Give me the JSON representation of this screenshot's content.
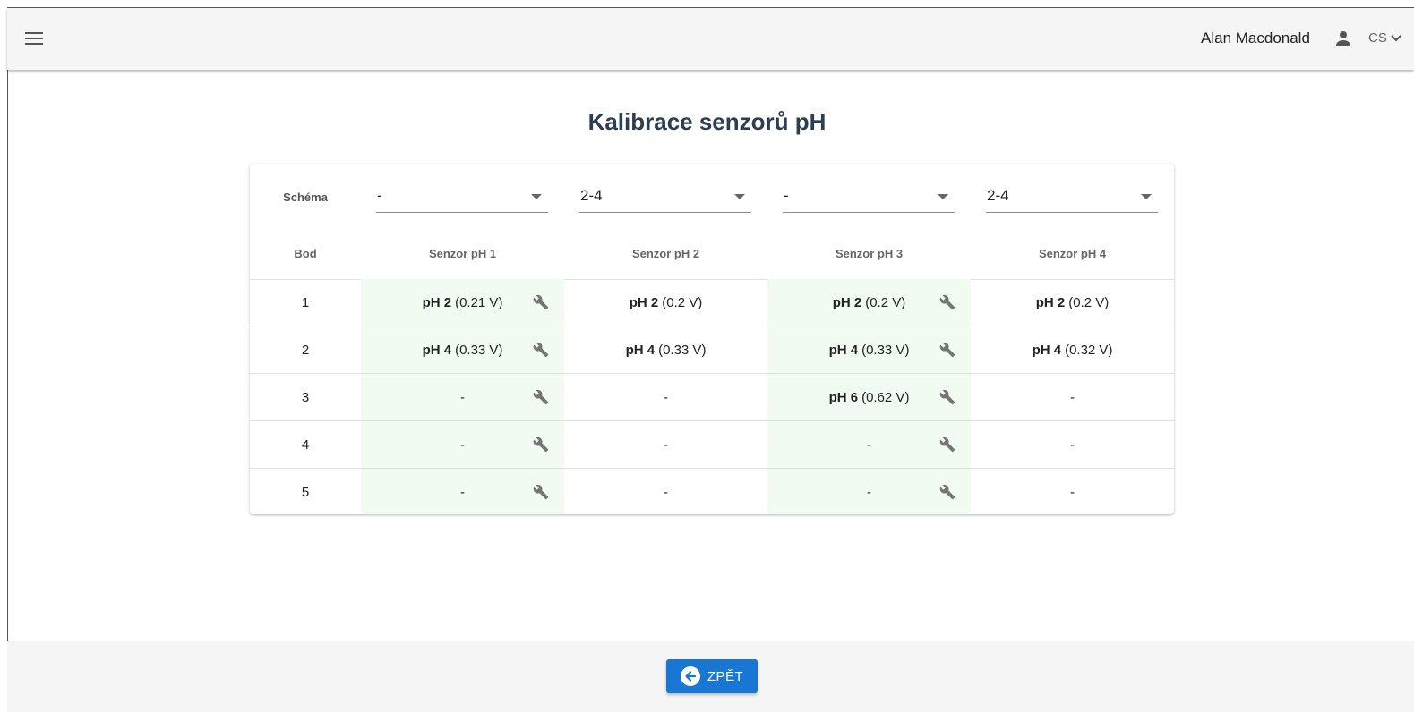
{
  "header": {
    "user_name": "Alan Macdonald",
    "language": "CS"
  },
  "page": {
    "title": "Kalibrace senzorů pH"
  },
  "schema": {
    "label": "Schéma",
    "selects": [
      {
        "value": "-"
      },
      {
        "value": "2-4"
      },
      {
        "value": "-"
      },
      {
        "value": "2-4"
      }
    ]
  },
  "table": {
    "headers": [
      "Bod",
      "Senzor pH 1",
      "Senzor pH 2",
      "Senzor pH 3",
      "Senzor pH 4"
    ],
    "rows": [
      {
        "point": "1",
        "cells": [
          {
            "ph": "pH 2",
            "volt": "(0.21 V)",
            "dash": ""
          },
          {
            "ph": "pH 2",
            "volt": "(0.2 V)",
            "dash": ""
          },
          {
            "ph": "pH 2",
            "volt": "(0.2 V)",
            "dash": ""
          },
          {
            "ph": "pH 2",
            "volt": "(0.2 V)",
            "dash": ""
          }
        ]
      },
      {
        "point": "2",
        "cells": [
          {
            "ph": "pH 4",
            "volt": "(0.33 V)",
            "dash": ""
          },
          {
            "ph": "pH 4",
            "volt": "(0.33 V)",
            "dash": ""
          },
          {
            "ph": "pH 4",
            "volt": "(0.33 V)",
            "dash": ""
          },
          {
            "ph": "pH 4",
            "volt": "(0.32 V)",
            "dash": ""
          }
        ]
      },
      {
        "point": "3",
        "cells": [
          {
            "ph": "",
            "volt": "",
            "dash": "-"
          },
          {
            "ph": "",
            "volt": "",
            "dash": "-"
          },
          {
            "ph": "pH 6",
            "volt": "(0.62 V)",
            "dash": ""
          },
          {
            "ph": "",
            "volt": "",
            "dash": "-"
          }
        ]
      },
      {
        "point": "4",
        "cells": [
          {
            "ph": "",
            "volt": "",
            "dash": "-"
          },
          {
            "ph": "",
            "volt": "",
            "dash": "-"
          },
          {
            "ph": "",
            "volt": "",
            "dash": "-"
          },
          {
            "ph": "",
            "volt": "",
            "dash": "-"
          }
        ]
      },
      {
        "point": "5",
        "cells": [
          {
            "ph": "",
            "volt": "",
            "dash": "-"
          },
          {
            "ph": "",
            "volt": "",
            "dash": "-"
          },
          {
            "ph": "",
            "volt": "",
            "dash": "-"
          },
          {
            "ph": "",
            "volt": "",
            "dash": "-"
          }
        ]
      }
    ]
  },
  "footer": {
    "back_label": "ZPĚT"
  },
  "colors": {
    "primary": "#1976d2",
    "editable_column": "#f1fbf1",
    "title": "#2c3e50"
  },
  "icons": {
    "menu": "menu-icon",
    "user": "person-icon",
    "language_caret": "chevron-down-icon",
    "calibrate": "wrench-icon",
    "back": "arrow-left-circle-icon"
  }
}
